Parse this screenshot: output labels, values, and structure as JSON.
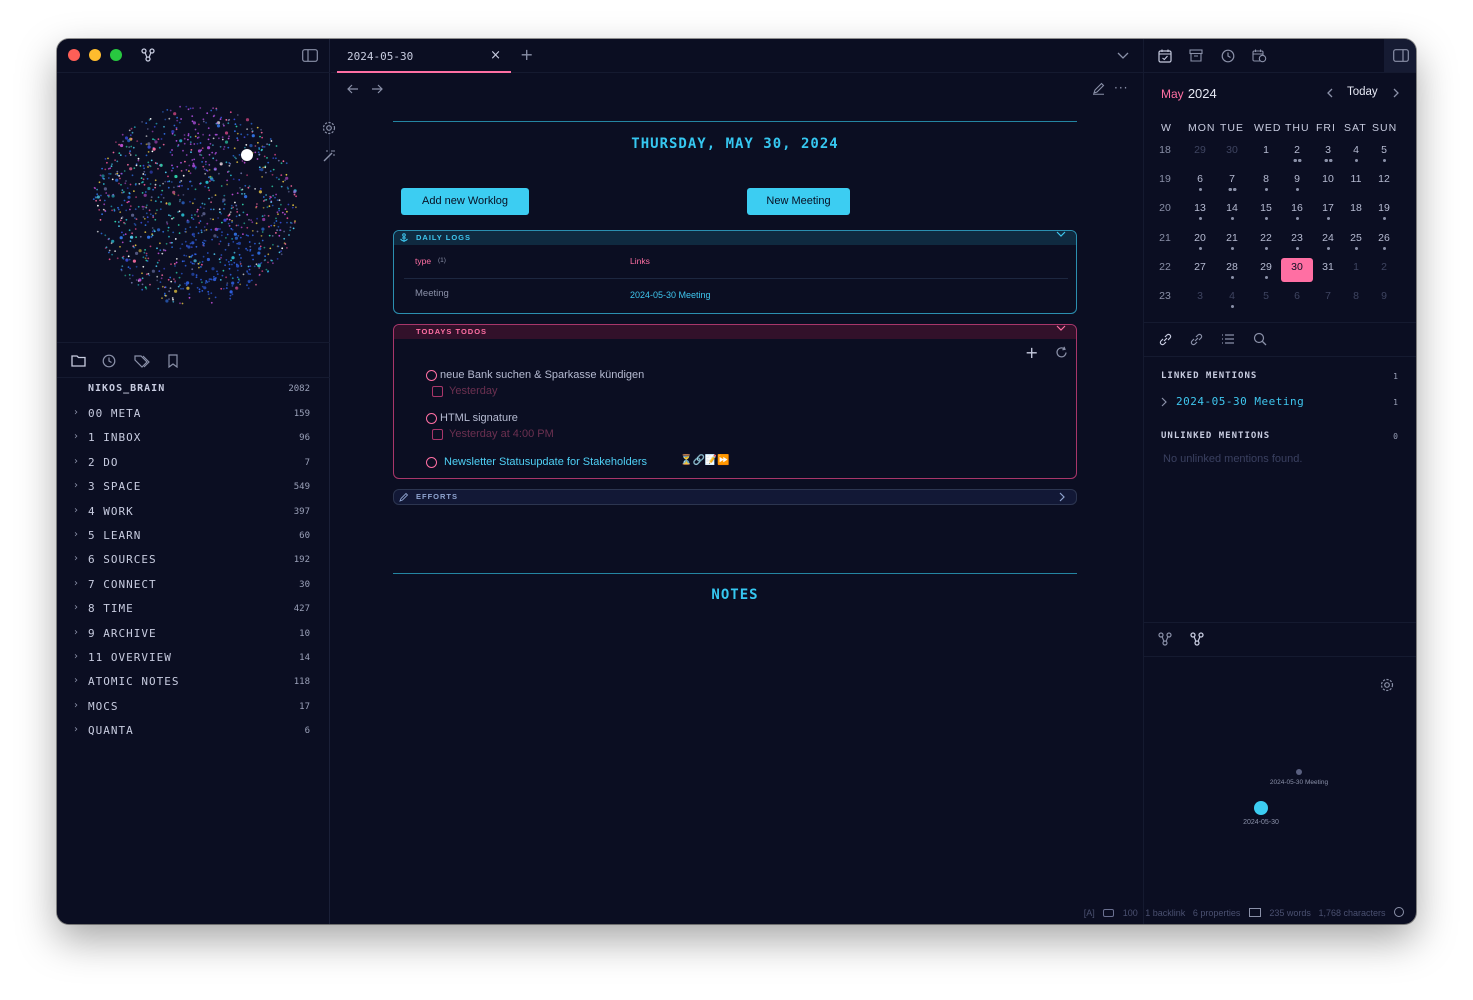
{
  "left_sidebar": {
    "root": {
      "label": "NIKOS_BRAIN",
      "count": "2082"
    },
    "folders": [
      {
        "label": "00 META",
        "count": "159"
      },
      {
        "label": "1 INBOX",
        "count": "96"
      },
      {
        "label": "2 DO",
        "count": "7"
      },
      {
        "label": "3 SPACE",
        "count": "549"
      },
      {
        "label": "4 WORK",
        "count": "397"
      },
      {
        "label": "5 LEARN",
        "count": "60"
      },
      {
        "label": "6 SOURCES",
        "count": "192"
      },
      {
        "label": "7 CONNECT",
        "count": "30"
      },
      {
        "label": "8 TIME",
        "count": "427"
      },
      {
        "label": "9 ARCHIVE",
        "count": "10"
      },
      {
        "label": "11 OVERVIEW",
        "count": "14"
      },
      {
        "label": "ATOMIC NOTES",
        "count": "118"
      },
      {
        "label": "MOCS",
        "count": "17"
      },
      {
        "label": "QUANTA",
        "count": "6"
      }
    ]
  },
  "tab": {
    "title": "2024-05-30",
    "close": "×",
    "new": "+"
  },
  "note": {
    "date_heading": "THURSDAY, MAY 30, 2024",
    "buttons": {
      "worklog": "Add new Worklog",
      "meeting": "New Meeting"
    },
    "daily_logs": {
      "title": "DAILY LOGS",
      "header_left": "type",
      "header_left_count": "(1)",
      "header_right": "Links",
      "row_left": "Meeting",
      "row_right": "2024-05-30 Meeting"
    },
    "todos": {
      "title": "TODAYS TODOS",
      "items": [
        {
          "text": "neue Bank suchen & Sparkasse kündigen",
          "date": "Yesterday"
        },
        {
          "text": "HTML signature",
          "date": "Yesterday at 4:00 PM"
        },
        {
          "text": "Newsletter Statusupdate for Stakeholders"
        }
      ],
      "item3_emojis": "⏳🔗📝⏩"
    },
    "efforts": {
      "title": "EFFORTS"
    },
    "notes_heading": "NOTES"
  },
  "calendar": {
    "month": "May",
    "year": "2024",
    "today_label": "Today",
    "dow": [
      "W",
      "MON",
      "TUE",
      "WED",
      "THU",
      "FRI",
      "SAT",
      "SUN"
    ],
    "weeks": [
      {
        "wk": "18",
        "days": [
          "29",
          "30",
          "1",
          "2",
          "3",
          "4",
          "5"
        ]
      },
      {
        "wk": "19",
        "days": [
          "6",
          "7",
          "8",
          "9",
          "10",
          "11",
          "12"
        ]
      },
      {
        "wk": "20",
        "days": [
          "13",
          "14",
          "15",
          "16",
          "17",
          "18",
          "19"
        ]
      },
      {
        "wk": "21",
        "days": [
          "20",
          "21",
          "22",
          "23",
          "24",
          "25",
          "26"
        ]
      },
      {
        "wk": "22",
        "days": [
          "27",
          "28",
          "29",
          "30",
          "31",
          "1",
          "2"
        ]
      },
      {
        "wk": "23",
        "days": [
          "3",
          "4",
          "5",
          "6",
          "7",
          "8",
          "9"
        ]
      }
    ],
    "selected_day": "30"
  },
  "backlinks": {
    "linked_title": "LINKED MENTIONS",
    "linked_count": "1",
    "linked_item": "2024-05-30 Meeting",
    "linked_item_count": "1",
    "unlinked_title": "UNLINKED MENTIONS",
    "unlinked_count": "0",
    "unlinked_empty": "No unlinked mentions found."
  },
  "local_graph": {
    "node_meeting": "2024-05-30 Meeting",
    "node_current": "2024-05-30"
  },
  "statusbar": {
    "mode": "[A]",
    "value": "100",
    "backlink": "1 backlink",
    "properties": "6 properties",
    "words": "235 words",
    "characters": "1,768 characters"
  },
  "colors": {
    "accent_cyan": "#36c7f0",
    "accent_pink": "#ff6fa3",
    "background": "#0b0e22"
  }
}
